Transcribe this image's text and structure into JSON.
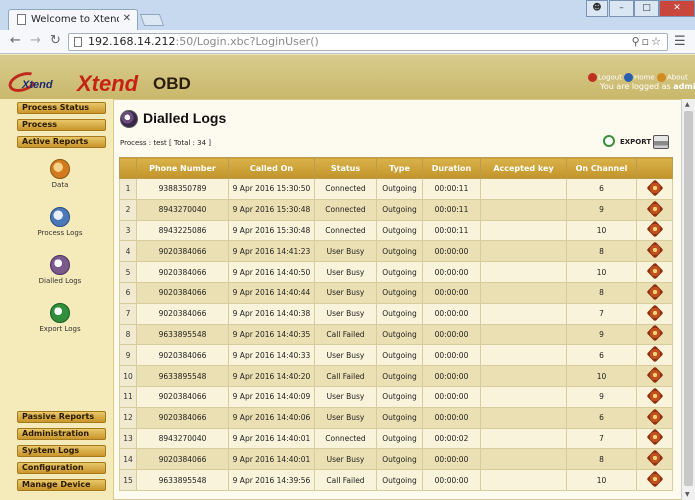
{
  "browser": {
    "tab_title": "Welcome to Xtend O",
    "tab_close": "✕",
    "url_host": "192.168.14.212",
    "url_rest": ":50/Login.xbc?LoginUser()",
    "icons": [
      "search-icon",
      "page-icon",
      "star-icon",
      "menu-icon"
    ]
  },
  "header": {
    "logo_small": "Xtend",
    "logo_big": "Xtend",
    "logo_obd": "OBD",
    "links": {
      "logout": "Logout",
      "home": "Home",
      "about": "About"
    },
    "logged_prefix": "You are logged as ",
    "user": "admin"
  },
  "sidebar": {
    "top_buttons": [
      "Process Status",
      "Process",
      "Active Reports"
    ],
    "items": [
      "Data",
      "Process Logs",
      "Dialled Logs",
      "Export Logs"
    ],
    "bottom_buttons": [
      "Passive Reports",
      "Administration",
      "System Logs",
      "Configuration",
      "Manage Device"
    ]
  },
  "main": {
    "title": "Dialled Logs",
    "process_info": "Process : test [ Total : 34 ]",
    "export_label": "EXPORT"
  },
  "table": {
    "columns": [
      "",
      "Phone Number",
      "Called On",
      "Status",
      "Type",
      "Duration",
      "Accepted key",
      "On Channel",
      ""
    ],
    "rows": [
      [
        "1",
        "9388350789",
        "9 Apr 2016 15:30:50",
        "Connected",
        "Outgoing",
        "00:00:11",
        "",
        "6"
      ],
      [
        "2",
        "8943270040",
        "9 Apr 2016 15:30:48",
        "Connected",
        "Outgoing",
        "00:00:11",
        "",
        "9"
      ],
      [
        "3",
        "8943225086",
        "9 Apr 2016 15:30:48",
        "Connected",
        "Outgoing",
        "00:00:11",
        "",
        "10"
      ],
      [
        "4",
        "9020384066",
        "9 Apr 2016 14:41:23",
        "User Busy",
        "Outgoing",
        "00:00:00",
        "",
        "8"
      ],
      [
        "5",
        "9020384066",
        "9 Apr 2016 14:40:50",
        "User Busy",
        "Outgoing",
        "00:00:00",
        "",
        "10"
      ],
      [
        "6",
        "9020384066",
        "9 Apr 2016 14:40:44",
        "User Busy",
        "Outgoing",
        "00:00:00",
        "",
        "8"
      ],
      [
        "7",
        "9020384066",
        "9 Apr 2016 14:40:38",
        "User Busy",
        "Outgoing",
        "00:00:00",
        "",
        "7"
      ],
      [
        "8",
        "9633895548",
        "9 Apr 2016 14:40:35",
        "Call Failed",
        "Outgoing",
        "00:00:00",
        "",
        "9"
      ],
      [
        "9",
        "9020384066",
        "9 Apr 2016 14:40:33",
        "User Busy",
        "Outgoing",
        "00:00:00",
        "",
        "6"
      ],
      [
        "10",
        "9633895548",
        "9 Apr 2016 14:40:20",
        "Call Failed",
        "Outgoing",
        "00:00:00",
        "",
        "10"
      ],
      [
        "11",
        "9020384066",
        "9 Apr 2016 14:40:09",
        "User Busy",
        "Outgoing",
        "00:00:00",
        "",
        "9"
      ],
      [
        "12",
        "9020384066",
        "9 Apr 2016 14:40:06",
        "User Busy",
        "Outgoing",
        "00:00:00",
        "",
        "6"
      ],
      [
        "13",
        "8943270040",
        "9 Apr 2016 14:40:01",
        "Connected",
        "Outgoing",
        "00:00:02",
        "",
        "7"
      ],
      [
        "14",
        "9020384066",
        "9 Apr 2016 14:40:01",
        "User Busy",
        "Outgoing",
        "00:00:00",
        "",
        "8"
      ],
      [
        "15",
        "9633895548",
        "9 Apr 2016 14:39:56",
        "Call Failed",
        "Outgoing",
        "00:00:00",
        "",
        "10"
      ]
    ]
  },
  "colors": {
    "header_bg": "#c9b86b",
    "table_header": "#c1942a",
    "logo_red": "#c52415",
    "logo_blue": "#1a2a70"
  }
}
